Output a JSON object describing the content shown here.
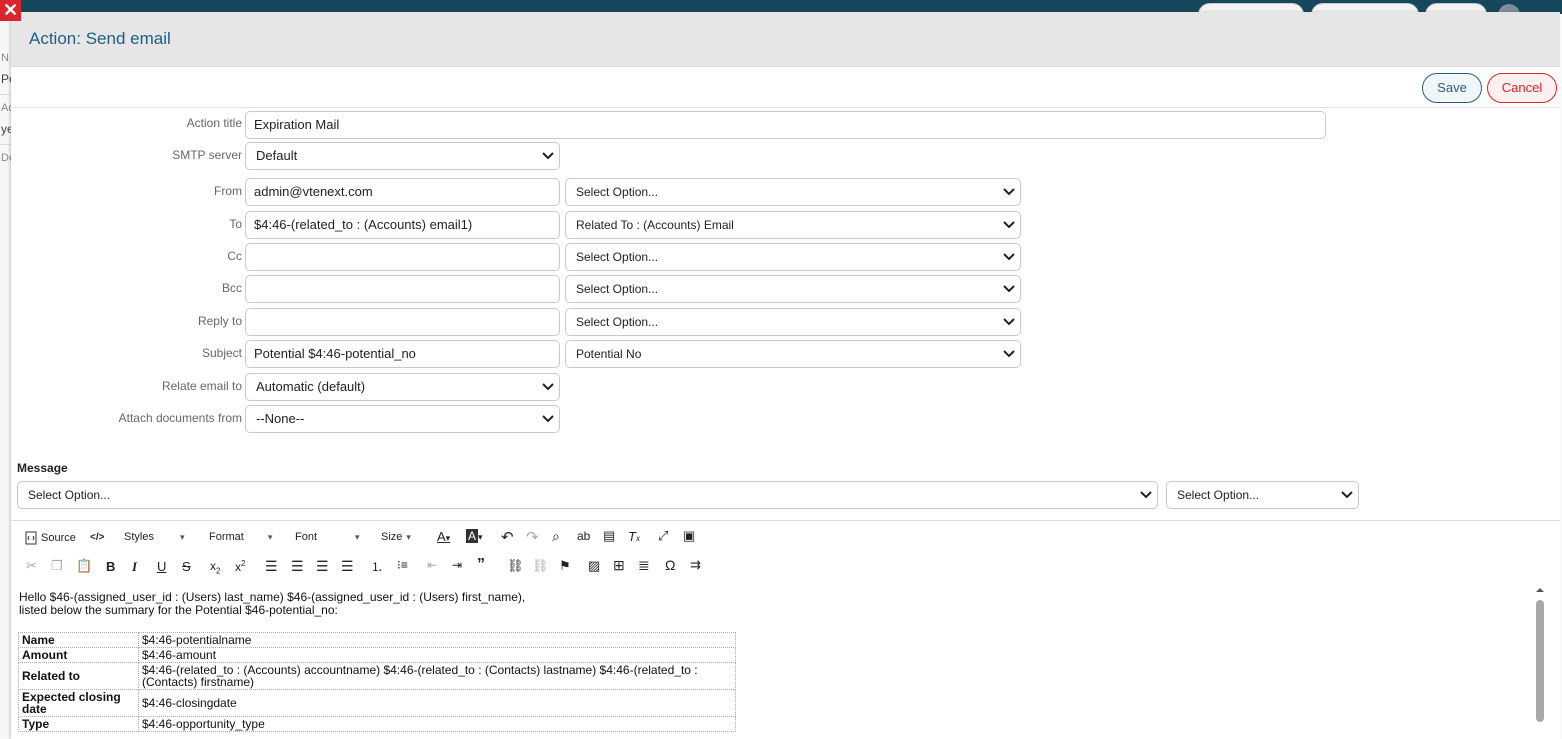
{
  "background": {
    "fragments": [
      "N",
      "Po",
      "Ac",
      "ye",
      "De"
    ]
  },
  "dialog": {
    "title": "Action: Send email",
    "save_label": "Save",
    "cancel_label": "Cancel"
  },
  "form": {
    "action_title": {
      "label": "Action title",
      "value": "Expiration Mail"
    },
    "smtp_server": {
      "label": "SMTP server",
      "value": "Default"
    },
    "from": {
      "label": "From",
      "value": "admin@vtenext.com",
      "option": "Select Option..."
    },
    "to": {
      "label": "To",
      "value": "$4:46-(related_to : (Accounts) email1)",
      "option": "Related To : (Accounts) Email"
    },
    "cc": {
      "label": "Cc",
      "value": "",
      "option": "Select Option..."
    },
    "bcc": {
      "label": "Bcc",
      "value": "",
      "option": "Select Option..."
    },
    "reply_to": {
      "label": "Reply to",
      "value": "",
      "option": "Select Option..."
    },
    "subject": {
      "label": "Subject",
      "value": "Potential  $4:46-potential_no",
      "option": "Potential No"
    },
    "relate_email": {
      "label": "Relate email to",
      "value": "Automatic (default)"
    },
    "attach_docs": {
      "label": "Attach documents from",
      "value": "--None--"
    }
  },
  "message": {
    "label": "Message",
    "select1": "Select Option...",
    "select2": "Select Option..."
  },
  "toolbar": {
    "source": "Source",
    "styles": "Styles",
    "format": "Format",
    "font": "Font",
    "size": "Size"
  },
  "body": {
    "line1": "Hello $46-(assigned_user_id : (Users) last_name) $46-(assigned_user_id : (Users) first_name),",
    "line2": "listed below the summary for the Potential $46-potential_no:",
    "rows": [
      {
        "key": "Name",
        "value": "$4:46-potentialname"
      },
      {
        "key": "Amount",
        "value": "$4:46-amount"
      },
      {
        "key": "Related to",
        "value": "$4:46-(related_to : (Accounts) accountname) $4:46-(related_to : (Contacts) lastname) $4:46-(related_to : (Contacts) firstname)"
      },
      {
        "key": "Expected closing date",
        "value": "$4:46-closingdate"
      },
      {
        "key": "Type",
        "value": "$4:46-opportunity_type"
      }
    ]
  }
}
